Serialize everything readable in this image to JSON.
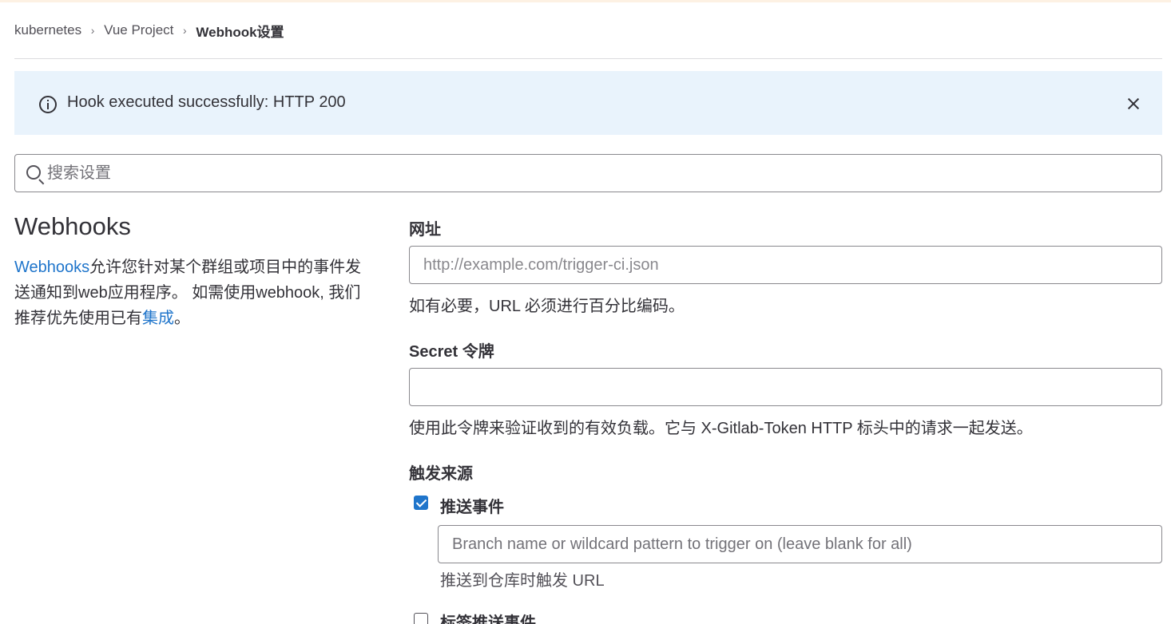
{
  "breadcrumb": {
    "items": [
      "kubernetes",
      "Vue Project",
      "Webhook设置"
    ],
    "separator": "›"
  },
  "alert": {
    "message": "Hook executed successfully: HTTP 200",
    "icon": "info-circle-icon",
    "close_icon": "close-icon"
  },
  "search": {
    "placeholder": "搜索设置",
    "icon": "search-icon"
  },
  "intro": {
    "title": "Webhooks",
    "link_webhooks": "Webhooks",
    "text_1": "允许您针对某个群组或项目中的事件发送通知到web应用程序。 如需使用webhook, 我们推荐优先使用已有",
    "link_integrations": "集成",
    "text_2": "。"
  },
  "form": {
    "url_label": "网址",
    "url_placeholder": "http://example.com/trigger-ci.json",
    "url_help": "如有必要，URL 必须进行百分比编码。",
    "secret_label": "Secret 令牌",
    "secret_value": "",
    "secret_help": "使用此令牌来验证收到的有效负载。它与 X-Gitlab-Token HTTP 标头中的请求一起发送。",
    "triggers_label": "触发来源",
    "push_events": {
      "label": "推送事件",
      "checked": true,
      "branch_placeholder": "Branch name or wildcard pattern to trigger on (leave blank for all)",
      "help": "推送到仓库时触发 URL"
    },
    "tag_push_events": {
      "label": "标签推送事件",
      "checked": false
    }
  },
  "colors": {
    "link": "#1f75cb",
    "alert_bg": "#e9f3fc",
    "checkbox_checked": "#1f75cb"
  }
}
